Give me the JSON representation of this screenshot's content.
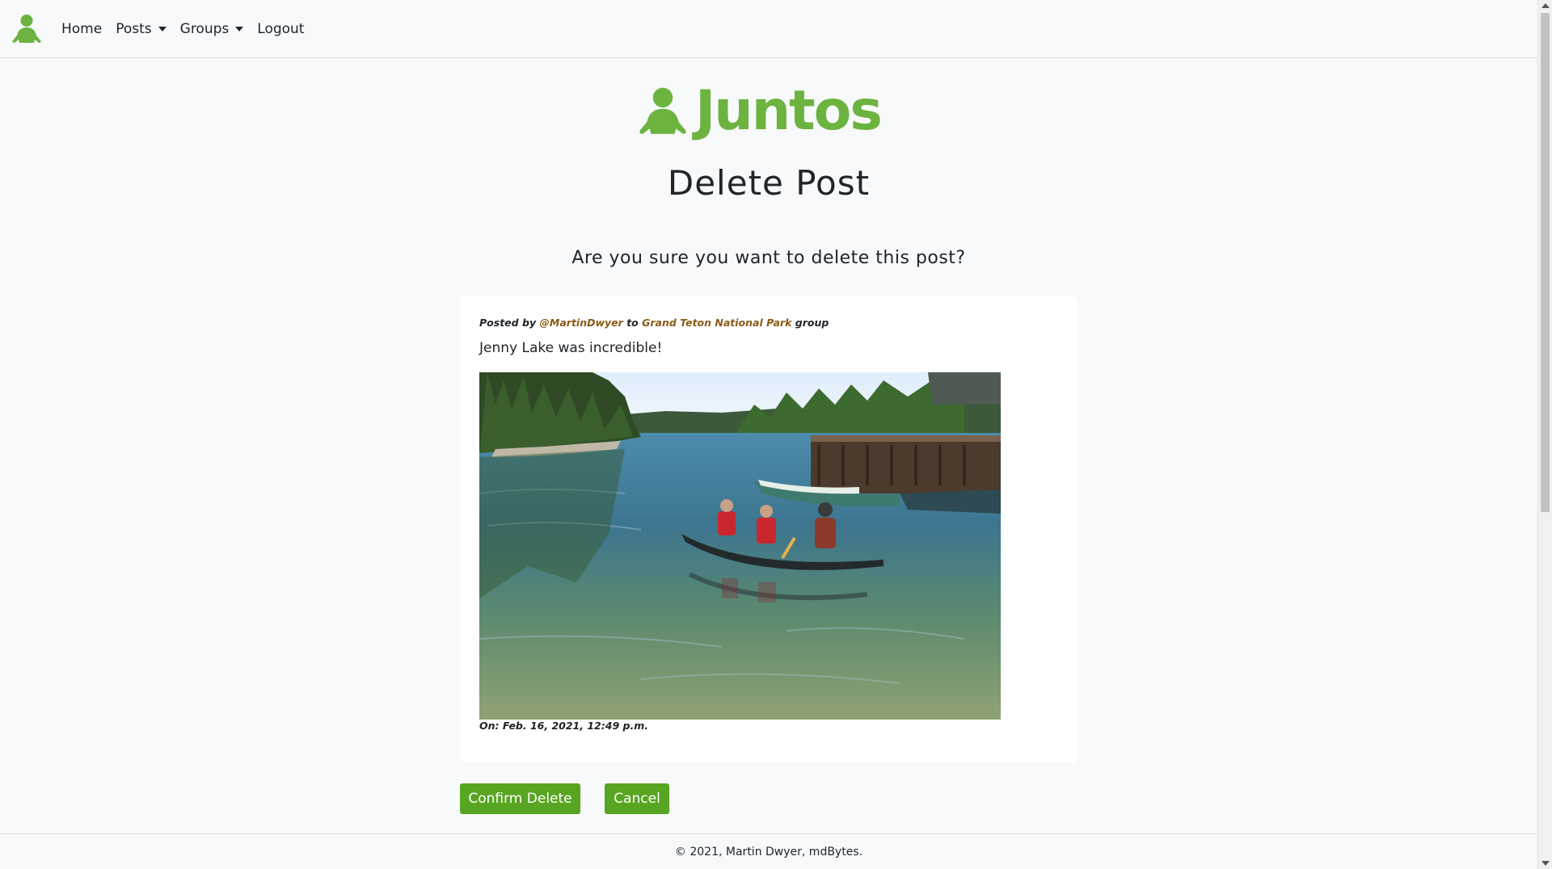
{
  "nav": {
    "items": [
      {
        "label": "Home",
        "dropdown": false
      },
      {
        "label": "Posts",
        "dropdown": true
      },
      {
        "label": "Groups",
        "dropdown": true
      },
      {
        "label": "Logout",
        "dropdown": false
      }
    ]
  },
  "brand": {
    "name": "Juntos",
    "color": "#6cb33f",
    "icon": "person-icon"
  },
  "page": {
    "title": "Delete Post",
    "question": "Are you sure you want to delete this post?"
  },
  "post": {
    "posted_by_prefix": "Posted by",
    "author": "@MartinDwyer",
    "to_word": "to",
    "group": "Grand Teton National Park",
    "group_suffix": "group",
    "body": "Jenny Lake was incredible!",
    "date": "On: Feb. 16, 2021, 12:49 p.m."
  },
  "actions": {
    "confirm_label": "Confirm Delete",
    "cancel_label": "Cancel",
    "button_color": "#58a522"
  },
  "footer": {
    "text": "© 2021, Martin Dwyer, mdBytes."
  }
}
